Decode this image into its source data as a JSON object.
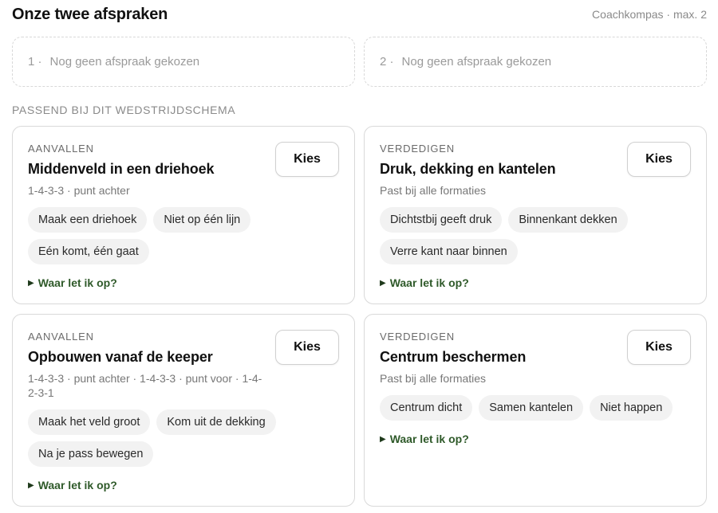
{
  "header": {
    "title": "Onze twee afspraken",
    "meta": "Coachkompas · max. 2"
  },
  "slots": [
    {
      "num": "1 ·",
      "text": "Nog geen afspraak gekozen"
    },
    {
      "num": "2 ·",
      "text": "Nog geen afspraak gekozen"
    }
  ],
  "section_label": "PASSEND BIJ DIT WEDSTRIJDSCHEMA",
  "cards": [
    {
      "category": "AANVALLEN",
      "title": "Middenveld in een driehoek",
      "subtitle": "1-4-3-3 · punt achter",
      "button": "Kies",
      "chips": [
        "Maak een driehoek",
        "Niet op één lijn",
        "Eén komt, één gaat"
      ],
      "tip": "Waar let ik op?"
    },
    {
      "category": "VERDEDIGEN",
      "title": "Druk, dekking en kantelen",
      "subtitle": "Past bij alle formaties",
      "button": "Kies",
      "chips": [
        "Dichtstbij geeft druk",
        "Binnenkant dekken",
        "Verre kant naar binnen"
      ],
      "tip": "Waar let ik op?"
    },
    {
      "category": "AANVALLEN",
      "title": "Opbouwen vanaf de keeper",
      "subtitle": "1-4-3-3 · punt achter · 1-4-3-3 · punt voor · 1-4-2-3-1",
      "button": "Kies",
      "chips": [
        "Maak het veld groot",
        "Kom uit de dekking",
        "Na je pass bewegen"
      ],
      "tip": "Waar let ik op?"
    },
    {
      "category": "VERDEDIGEN",
      "title": "Centrum beschermen",
      "subtitle": "Past bij alle formaties",
      "button": "Kies",
      "chips": [
        "Centrum dicht",
        "Samen kantelen",
        "Niet happen"
      ],
      "tip": "Waar let ik op?"
    }
  ]
}
